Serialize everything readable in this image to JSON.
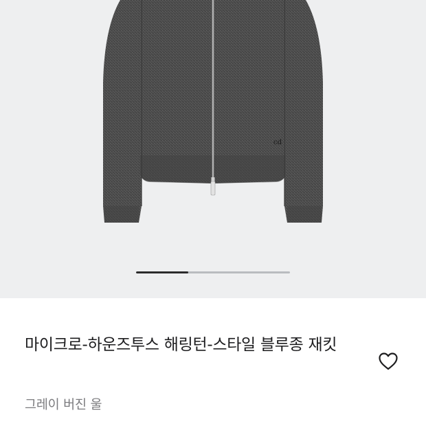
{
  "product": {
    "name": "마이크로-하운즈투스 해링턴-스타일 블루종 재킷",
    "color_material": "그레이 버진 울"
  },
  "gallery": {
    "slide_progress": 0.34
  },
  "icons": {
    "wishlist": "heart-outline-icon"
  },
  "colors": {
    "gallery_background": "#eeeff0",
    "progress_active": "#2b2b2b",
    "progress_track": "#b9bcbf",
    "jacket": "#4a4a4a"
  }
}
